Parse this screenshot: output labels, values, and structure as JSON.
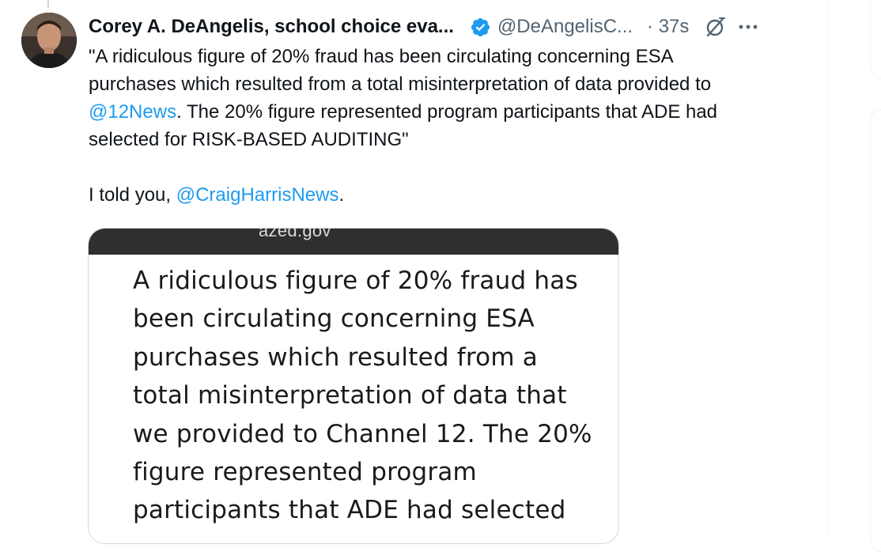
{
  "tweet": {
    "display_name": "Corey A. DeAngelis, school choice eva...",
    "handle": "@DeAngelisC...",
    "time": "· 37s",
    "text_lines": [
      "\"A ridiculous figure of 20% fraud has been circulating concerning ESA",
      "purchases which resulted from a total misinterpretation of data provided to",
      ". The 20% figure represented program participants that ADE had",
      "selected for RISK-BASED AUDITING\""
    ],
    "mention_12news": "@12News",
    "para2_prefix": "I told you, ",
    "mention_craig": "@CraigHarrisNews",
    "para2_suffix": "."
  },
  "media": {
    "url_text": "azed.gov",
    "lines": [
      "A ridiculous figure of 20% fraud has",
      "been circulating concerning ESA",
      "purchases which resulted from a",
      "total misinterpretation of data that",
      "we provided to Channel 12. The 20%",
      "figure represented program",
      "participants that ADE had selected"
    ]
  },
  "icons": {
    "verified": "verified-badge-icon",
    "grok": "grok-icon",
    "more": "more-options-icon"
  },
  "colors": {
    "link": "#1d9bf0",
    "secondary_text": "#536471",
    "verified": "#1d9bf0"
  }
}
